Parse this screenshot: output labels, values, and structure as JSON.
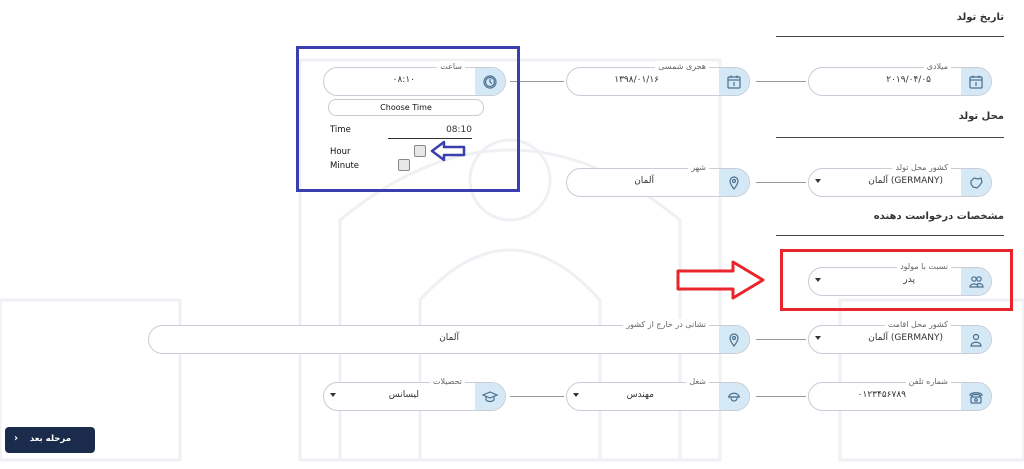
{
  "sections": {
    "birth_date": "تاریخ تولد",
    "birth_place": "محل تولد",
    "applicant": "مشخصات درخواست دهنده"
  },
  "fields": {
    "gregorian": {
      "label": "میلادی",
      "value": "۲۰۱۹/۰۴/۰۵"
    },
    "hijri": {
      "label": "هجری شمسی",
      "value": "۱۳۹۸/۰۱/۱۶"
    },
    "time": {
      "label": "ساعت",
      "value": "۰۸:۱۰"
    },
    "birth_country": {
      "label": "کشور محل تولد",
      "value": "آلمان (GERMANY)"
    },
    "city": {
      "label": "شهر",
      "value": "آلمان"
    },
    "relation": {
      "label": "نسبت با مولود",
      "value": "پدر"
    },
    "residence_country": {
      "label": "کشور محل اقامت",
      "value": "آلمان (GERMANY)"
    },
    "abroad_address": {
      "label": "نشانی در خارج از کشور",
      "value": "آلمان"
    },
    "phone": {
      "label": "شماره تلفن",
      "value": "۰۱۲۳۴۵۶۷۸۹"
    },
    "job": {
      "label": "شغل",
      "value": "مهندس"
    },
    "education": {
      "label": "تحصیلات",
      "value": "لیسانس"
    }
  },
  "time_picker": {
    "choose_label": "Choose Time",
    "time_label": "Time",
    "time_value": "08:10",
    "hour_label": "Hour",
    "minute_label": "Minute"
  },
  "next_button": {
    "label": "مرحله بعد",
    "arrow": "›"
  },
  "colors": {
    "blue_highlight": "#3a3fb0",
    "red_highlight": "#e8262b",
    "icon_bg": "#d5e8f5",
    "icon_stroke": "#4a6f8f",
    "button_bg": "#1b2b4b"
  },
  "icons": {
    "gregorian": "calendar-icon",
    "hijri": "calendar-icon",
    "time": "clock-icon",
    "birth_country": "map-icon",
    "city": "location-pin-icon",
    "relation": "users-icon",
    "residence_country": "user-location-icon",
    "abroad_address": "location-pin-icon",
    "phone": "phone-icon",
    "job": "worker-icon",
    "education": "graduation-cap-icon"
  }
}
